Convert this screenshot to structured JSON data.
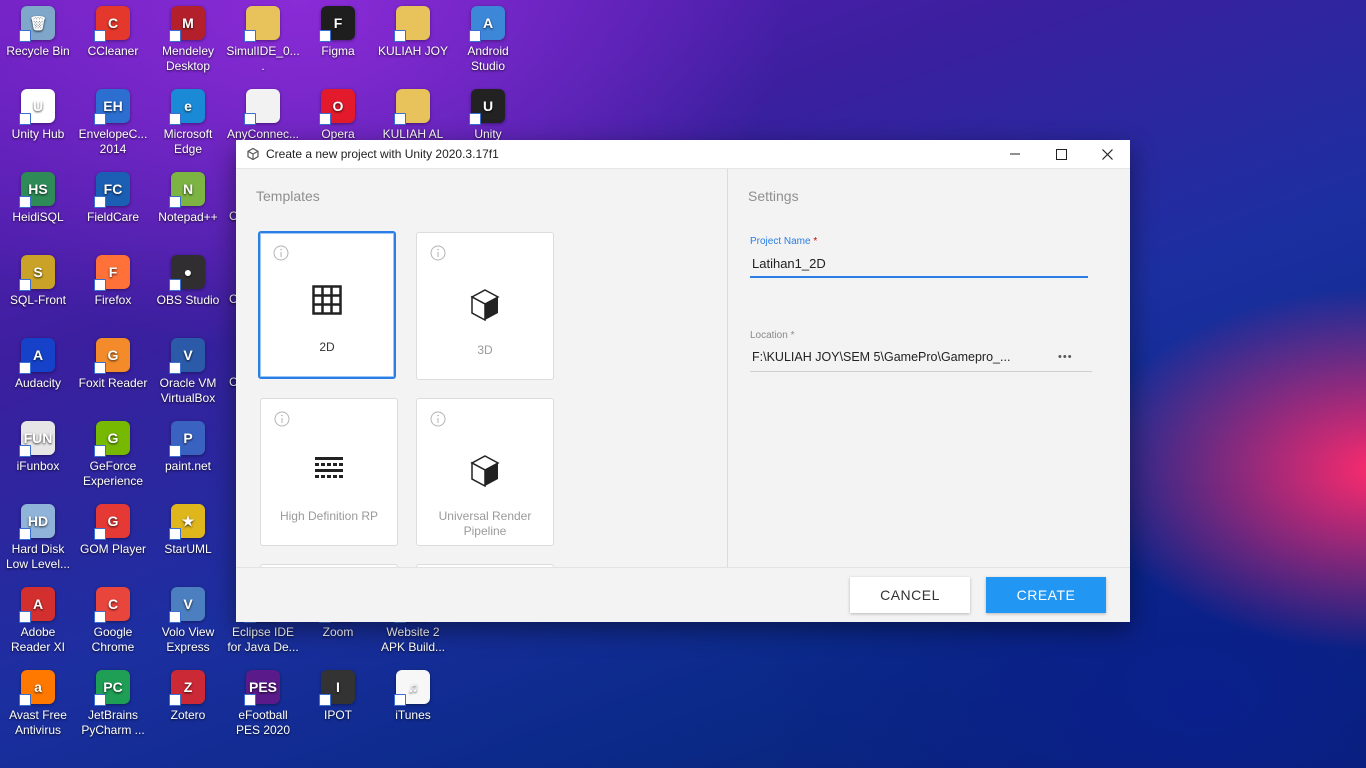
{
  "desktop": {
    "icons": [
      {
        "label": "Recycle Bin",
        "icon": "recycle-bin-icon",
        "color": "#7fa7c9",
        "glyph": "🗑"
      },
      {
        "label": "CCleaner",
        "icon": "ccleaner-icon",
        "color": "#e3382b",
        "glyph": "C"
      },
      {
        "label": "Mendeley Desktop",
        "icon": "mendeley-icon",
        "color": "#b3202c",
        "glyph": "M"
      },
      {
        "label": "SimulIDE_0....",
        "icon": "folder-icon",
        "color": "#e8c25a",
        "glyph": ""
      },
      {
        "label": "Figma",
        "icon": "figma-icon",
        "color": "#1e1e1e",
        "glyph": "F"
      },
      {
        "label": "KULIAH JOY",
        "icon": "folder-icon",
        "color": "#e8c25a",
        "glyph": ""
      },
      {
        "label": "Android Studio",
        "icon": "android-studio-icon",
        "color": "#3d87d8",
        "glyph": "A"
      },
      {
        "label": "Unity Hub",
        "icon": "unity-hub-icon",
        "color": "#ffffff",
        "glyph": "U"
      },
      {
        "label": "EnvelopeC... 2014",
        "icon": "envelope-icon",
        "color": "#2c6fd1",
        "glyph": "EH"
      },
      {
        "label": "Microsoft Edge",
        "icon": "edge-icon",
        "color": "#1b8ad6",
        "glyph": "e"
      },
      {
        "label": "AnyConnec...",
        "icon": "document-icon",
        "color": "#f2f2f2",
        "glyph": ""
      },
      {
        "label": "Opera",
        "icon": "opera-icon",
        "color": "#e21a2c",
        "glyph": "O"
      },
      {
        "label": "KULIAH AL",
        "icon": "folder-icon",
        "color": "#e8c25a",
        "glyph": ""
      },
      {
        "label": "Unity",
        "icon": "unity-icon",
        "color": "#222222",
        "glyph": "U"
      },
      {
        "label": "HeidiSQL",
        "icon": "heidisql-icon",
        "color": "#2e8b57",
        "glyph": "HS"
      },
      {
        "label": "FieldCare",
        "icon": "fieldcare-icon",
        "color": "#1a5fb4",
        "glyph": "FC"
      },
      {
        "label": "Notepad++",
        "icon": "notepadpp-icon",
        "color": "#7cb342",
        "glyph": "N"
      },
      {
        "label": "SQL-Front",
        "icon": "sql-front-icon",
        "color": "#c9a227",
        "glyph": "S"
      },
      {
        "label": "Firefox",
        "icon": "firefox-icon",
        "color": "#ff7139",
        "glyph": "F"
      },
      {
        "label": "OBS Studio",
        "icon": "obs-icon",
        "color": "#302e31",
        "glyph": "●"
      },
      {
        "label": "Audacity",
        "icon": "audacity-icon",
        "color": "#1542c9",
        "glyph": "A"
      },
      {
        "label": "Foxit Reader",
        "icon": "foxit-icon",
        "color": "#f38b2b",
        "glyph": "G"
      },
      {
        "label": "Oracle VM VirtualBox",
        "icon": "virtualbox-icon",
        "color": "#2a5aa8",
        "glyph": "V"
      },
      {
        "label": "iFunbox",
        "icon": "ifunbox-icon",
        "color": "#e6e6e6",
        "glyph": "FUN"
      },
      {
        "label": "GeForce Experience",
        "icon": "geforce-icon",
        "color": "#76b900",
        "glyph": "G"
      },
      {
        "label": "paint.net",
        "icon": "paintnet-icon",
        "color": "#3a62c0",
        "glyph": "P"
      },
      {
        "label": "Hard Disk Low Level...",
        "icon": "hard-disk-icon",
        "color": "#8fb3d9",
        "glyph": "HD"
      },
      {
        "label": "GOM Player",
        "icon": "gom-player-icon",
        "color": "#e53935",
        "glyph": "G"
      },
      {
        "label": "StarUML",
        "icon": "staruml-icon",
        "color": "#e0b61d",
        "glyph": "★"
      },
      {
        "label": "Adobe Reader XI",
        "icon": "adobe-reader-icon",
        "color": "#d32f2f",
        "glyph": "A"
      },
      {
        "label": "Google Chrome",
        "icon": "chrome-icon",
        "color": "#e8453c",
        "glyph": "C"
      },
      {
        "label": "Volo View Express",
        "icon": "volo-view-icon",
        "color": "#4c7fbf",
        "glyph": "V"
      },
      {
        "label": "Eclipse IDE for Java De...",
        "icon": "eclipse-icon",
        "color": "#2c2255",
        "glyph": "E"
      },
      {
        "label": "Zoom",
        "icon": "zoom-icon",
        "color": "#2d8cff",
        "glyph": "Z"
      },
      {
        "label": "Website 2 APK Build...",
        "icon": "website-apk-icon",
        "color": "#3aa657",
        "glyph": "W"
      },
      {
        "label": "Avast Free Antivirus",
        "icon": "avast-icon",
        "color": "#ff7800",
        "glyph": "a"
      },
      {
        "label": "JetBrains PyCharm ...",
        "icon": "pycharm-icon",
        "color": "#1f9e55",
        "glyph": "PC"
      },
      {
        "label": "Zotero",
        "icon": "zotero-icon",
        "color": "#cc2936",
        "glyph": "Z"
      },
      {
        "label": "eFootball PES 2020",
        "icon": "pes-icon",
        "color": "#5a1a8a",
        "glyph": "PES"
      },
      {
        "label": "IPOT",
        "icon": "ipot-icon",
        "color": "#333333",
        "glyph": "I"
      },
      {
        "label": "iTunes",
        "icon": "itunes-icon",
        "color": "#f7f7f7",
        "glyph": "♫"
      }
    ],
    "partial_labels": [
      "C",
      "C",
      "C"
    ]
  },
  "dialog": {
    "title": "Create a new project with Unity 2020.3.17f1",
    "templates_heading": "Templates",
    "settings_heading": "Settings",
    "templates": [
      {
        "name": "2D",
        "icon": "grid-icon",
        "selected": true
      },
      {
        "name": "3D",
        "icon": "cube-icon",
        "selected": false
      },
      {
        "name": "High Definition RP",
        "icon": "hdrp-icon",
        "selected": false
      },
      {
        "name": "Universal Render Pipeline",
        "icon": "cube-icon",
        "selected": false
      }
    ],
    "project_name": {
      "label": "Project Name",
      "required_mark": "*",
      "value": "Latihan1_2D"
    },
    "location": {
      "label": "Location",
      "required_mark": "*",
      "value": "F:\\KULIAH JOY\\SEM 5\\GamePro\\Gamepro_...",
      "browse": "•••"
    },
    "buttons": {
      "cancel": "CANCEL",
      "create": "CREATE"
    },
    "accent_color": "#2196f3"
  }
}
